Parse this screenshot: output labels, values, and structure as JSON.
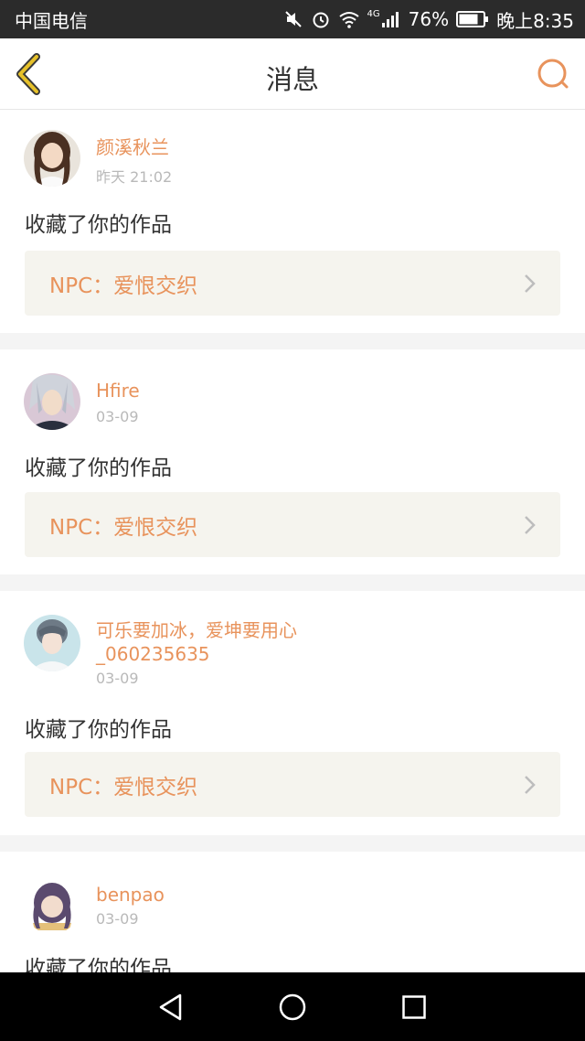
{
  "status_bar": {
    "carrier": "中国电信",
    "network_label": "4G",
    "battery": "76%",
    "time": "晚上8:35",
    "icons": [
      "mute-icon",
      "alarm-icon",
      "wifi-icon",
      "signal-icon",
      "battery-icon"
    ]
  },
  "nav": {
    "title": "消息",
    "back_icon": "back-chevron-icon",
    "search_icon": "search-icon",
    "accent": "#e8935c",
    "back_color": "#e6c12a"
  },
  "messages": [
    {
      "username": "颜溪秋兰",
      "time": "昨天 21:02",
      "action": "收藏了你的作品",
      "work": "NPC：爱恨交织"
    },
    {
      "username": "Hfire",
      "time": "03-09",
      "action": "收藏了你的作品",
      "work": "NPC：爱恨交织"
    },
    {
      "username": "可乐要加冰，爱坤要用心_060235635",
      "time": "03-09",
      "action": "收藏了你的作品",
      "work": "NPC：爱恨交织"
    },
    {
      "username": "benpao",
      "time": "03-09",
      "action": "收藏了你的作品",
      "work": ""
    }
  ],
  "system_nav": {
    "icons": [
      "back-triangle-icon",
      "home-circle-icon",
      "recents-square-icon"
    ]
  }
}
